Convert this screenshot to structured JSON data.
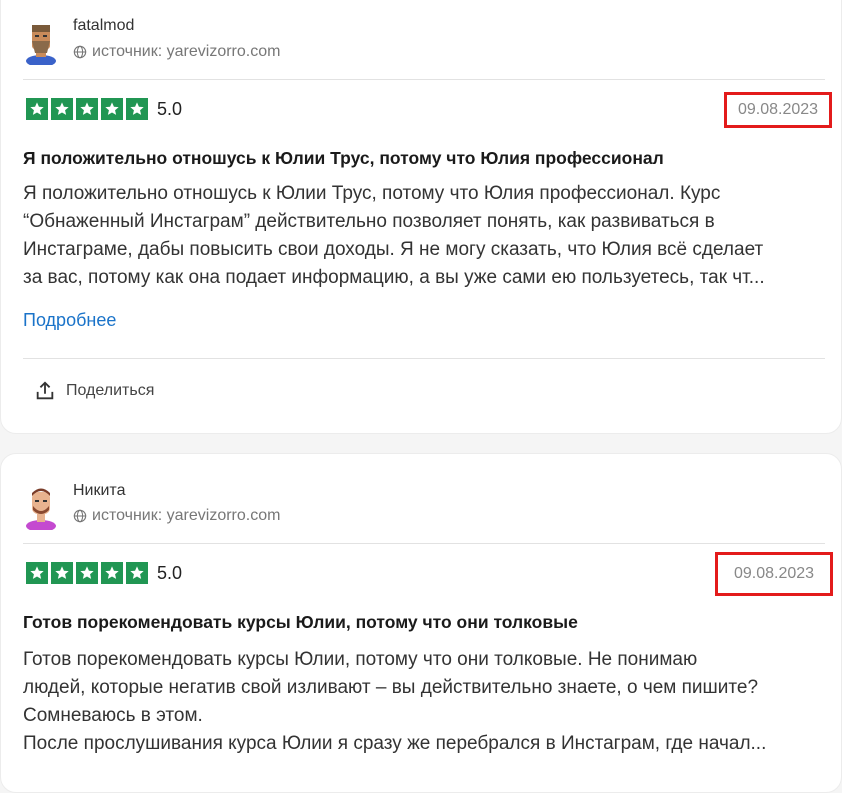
{
  "reviews": [
    {
      "author": "fatalmod",
      "source": "источник: yarevizorro.com",
      "rating": "5.0",
      "stars": 5,
      "date": "09.08.2023",
      "title": "Я положительно отношусь к Юлии Трус, потому что Юлия профессионал",
      "body_lines": [
        "Я положительно отношусь к Юлии Трус, потому что Юлия профессионал. Курс",
        "“Обнаженный Инстаграм” действительно позволяет понять, как развиваться в",
        "Инстаграме, дабы повысить свои доходы. Я не могу сказать, что Юлия всё сделает",
        "за вас, потому как она подает информацию, а вы уже сами ею пользуетесь, так чт..."
      ],
      "more_label": "Подробнее",
      "share_label": "Поделиться",
      "avatar_icon": "bearded-man-avatar-icon"
    },
    {
      "author": "Никита",
      "source": "источник: yarevizorro.com",
      "rating": "5.0",
      "stars": 5,
      "date": "09.08.2023",
      "title": "Готов порекомендовать курсы Юлии, потому что они толковые",
      "body_lines": [
        "Готов порекомендовать курсы Юлии, потому что они толковые. Не понимаю",
        "людей, которые негатив свой изливают – вы действительно знаете, о чем пишите?",
        "Сомневаюсь в этом.",
        "После прослушивания курса Юлии я сразу же перебрался в Инстаграм, где начал..."
      ],
      "avatar_icon": "man-avatar-icon"
    }
  ],
  "colors": {
    "star_green": "#219653",
    "highlight_red": "#e31b1b",
    "link_blue": "#1a73c9"
  }
}
